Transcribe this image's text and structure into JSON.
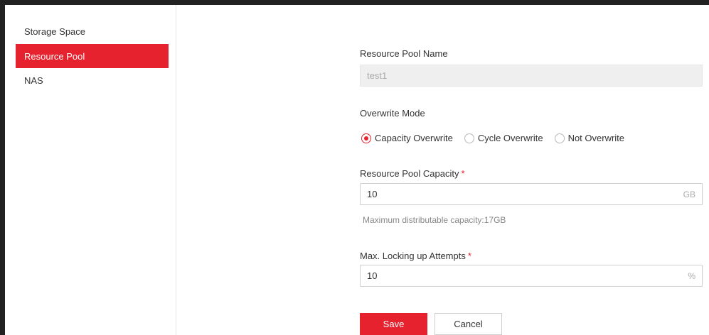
{
  "sidebar": {
    "items": [
      {
        "label": "Storage Space",
        "active": false
      },
      {
        "label": "Resource Pool",
        "active": true
      },
      {
        "label": "NAS",
        "active": false
      }
    ]
  },
  "form": {
    "pool_name": {
      "label": "Resource Pool Name",
      "value": "test1"
    },
    "overwrite": {
      "label": "Overwrite Mode",
      "options": [
        {
          "label": "Capacity Overwrite",
          "checked": true
        },
        {
          "label": "Cycle Overwrite",
          "checked": false
        },
        {
          "label": "Not Overwrite",
          "checked": false
        }
      ]
    },
    "capacity": {
      "label": "Resource Pool Capacity",
      "required": "*",
      "value": "10",
      "unit": "GB",
      "hint": "Maximum distributable capacity:17GB"
    },
    "locking": {
      "label": "Max. Locking up Attempts",
      "required": "*",
      "value": "10",
      "unit": "%"
    }
  },
  "actions": {
    "save_label": "Save",
    "cancel_label": "Cancel"
  },
  "colors": {
    "accent": "#e5222d"
  }
}
